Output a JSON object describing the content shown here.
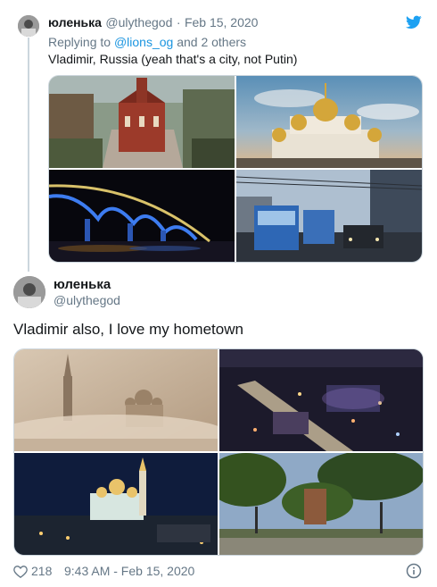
{
  "reply_tweet": {
    "display_name": "юленька",
    "handle": "@ulythegod",
    "separator": "·",
    "date": "Feb 15, 2020",
    "replying_prefix": "Replying to",
    "replying_mention": "@lions_og",
    "replying_suffix": "and 2 others",
    "text": "Vladimir, Russia (yeah that's a city, not Putin)",
    "photos": [
      "church-photo",
      "cathedral-golden-domes-photo",
      "bridge-at-night-photo",
      "trolleybus-street-photo"
    ]
  },
  "main_tweet": {
    "display_name": "юленька",
    "handle": "@ulythegod",
    "text": "Vladimir also, I love my hometown",
    "photos": [
      "foggy-cathedral-photo",
      "city-night-aerial-photo",
      "illuminated-cathedral-night-photo",
      "park-trees-photo"
    ],
    "like_count": "218",
    "timestamp": "9:43 AM - Feb 15, 2020"
  },
  "colors": {
    "twitter_blue": "#1da1f2",
    "link": "#1b95e0",
    "gray_text": "#657786",
    "border": "#ccd6dd"
  },
  "icons": [
    "twitter-bird-icon",
    "heart-icon",
    "info-icon"
  ]
}
